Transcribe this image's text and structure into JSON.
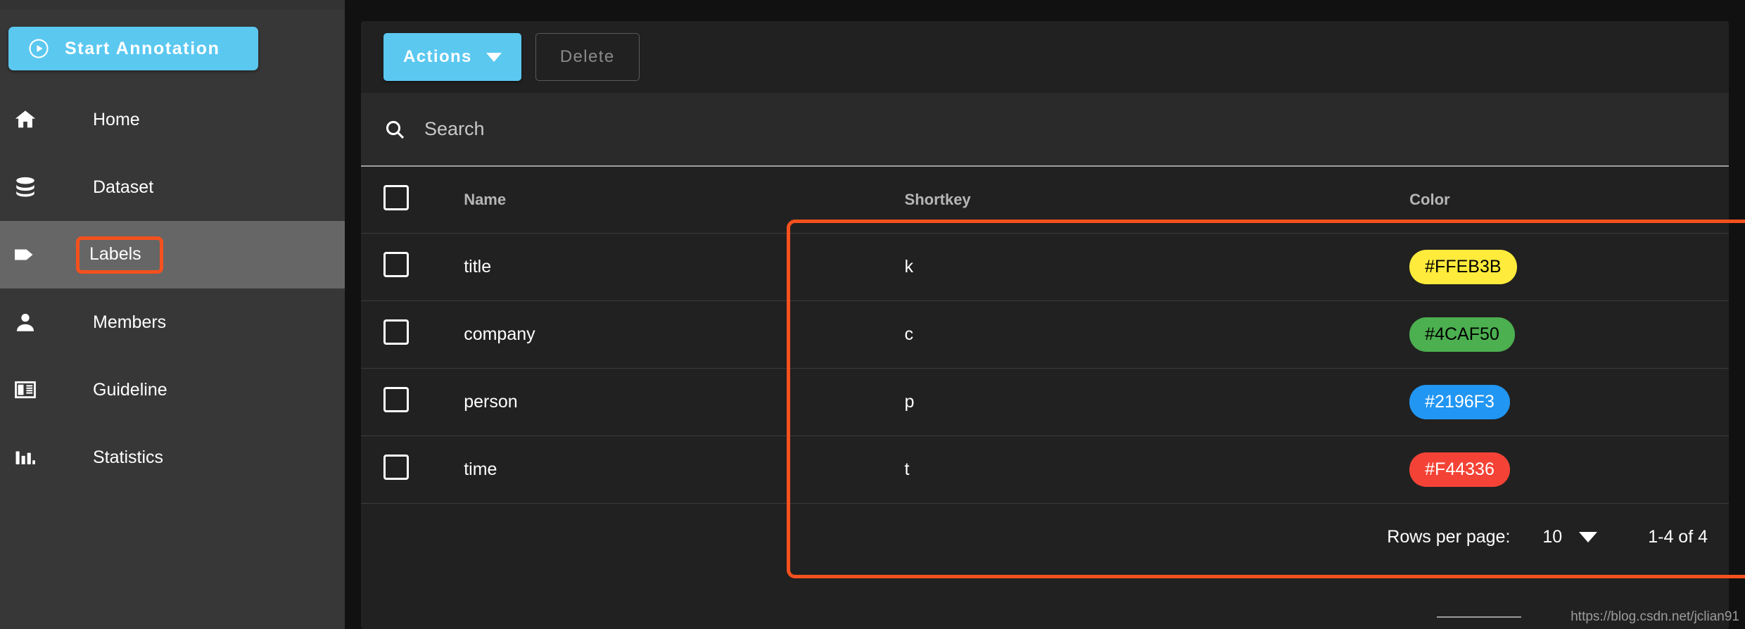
{
  "sidebar": {
    "start_button": {
      "label": "Start Annotation",
      "icon": "play-circle-icon",
      "color": "#5BC8F0"
    },
    "items": [
      {
        "label": "Home",
        "icon": "home-icon",
        "active": false
      },
      {
        "label": "Dataset",
        "icon": "database-icon",
        "active": false
      },
      {
        "label": "Labels",
        "icon": "tag-icon",
        "active": true
      },
      {
        "label": "Members",
        "icon": "person-icon",
        "active": false
      },
      {
        "label": "Guideline",
        "icon": "book-icon",
        "active": false
      },
      {
        "label": "Statistics",
        "icon": "bar-chart-icon",
        "active": false
      }
    ]
  },
  "toolbar": {
    "actions_label": "Actions",
    "delete_label": "Delete"
  },
  "search": {
    "placeholder": "Search",
    "value": "",
    "icon": "search-icon"
  },
  "table": {
    "columns": [
      "Name",
      "Shortkey",
      "Color"
    ],
    "rows": [
      {
        "name": "title",
        "shortkey": "k",
        "color": "#FFEB3B",
        "color_text": "#000000"
      },
      {
        "name": "company",
        "shortkey": "c",
        "color": "#4CAF50",
        "color_text": "#000000"
      },
      {
        "name": "person",
        "shortkey": "p",
        "color": "#2196F3",
        "color_text": "#FFFFFF"
      },
      {
        "name": "time",
        "shortkey": "t",
        "color": "#F44336",
        "color_text": "#FFFFFF"
      }
    ]
  },
  "pagination": {
    "rows_per_page_label": "Rows per page:",
    "rows_per_page_value": "10",
    "range_label": "1-4 of 4"
  },
  "watermark": {
    "text": "https://blog.csdn.net/jclian91"
  },
  "highlight": {
    "color": "#F4511E"
  }
}
